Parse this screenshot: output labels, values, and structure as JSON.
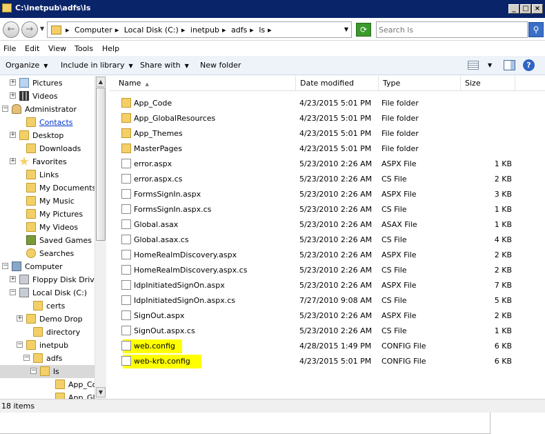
{
  "window": {
    "title": "C:\\inetpub\\adfs\\ls"
  },
  "address": {
    "crumbs": [
      "Computer",
      "Local Disk (C:)",
      "inetpub",
      "adfs",
      "ls"
    ],
    "search_placeholder": "Search ls"
  },
  "menu": {
    "items": [
      "File",
      "Edit",
      "View",
      "Tools",
      "Help"
    ]
  },
  "toolbar": {
    "organize": "Organize",
    "include": "Include in library",
    "share": "Share with",
    "new_folder": "New folder"
  },
  "nav": {
    "items": [
      {
        "label": "Pictures",
        "icon": "pictures-icon"
      },
      {
        "label": "Videos",
        "icon": "videos-icon"
      },
      {
        "label": "Administrator",
        "icon": "user-folder-icon"
      },
      {
        "label": "Contacts",
        "icon": "contacts-folder-icon"
      },
      {
        "label": "Desktop",
        "icon": "folder-icon"
      },
      {
        "label": "Downloads",
        "icon": "folder-icon"
      },
      {
        "label": "Favorites",
        "icon": "star-icon"
      },
      {
        "label": "Links",
        "icon": "folder-icon"
      },
      {
        "label": "My Documents",
        "icon": "folder-icon"
      },
      {
        "label": "My Music",
        "icon": "folder-icon"
      },
      {
        "label": "My Pictures",
        "icon": "folder-icon"
      },
      {
        "label": "My Videos",
        "icon": "folder-icon"
      },
      {
        "label": "Saved Games",
        "icon": "saved-games-icon"
      },
      {
        "label": "Searches",
        "icon": "search-folder-icon"
      },
      {
        "label": "Computer",
        "icon": "computer-icon"
      },
      {
        "label": "Floppy Disk Drive",
        "icon": "floppy-drive-icon"
      },
      {
        "label": "Local Disk (C:)",
        "icon": "local-disk-icon"
      },
      {
        "label": "certs",
        "icon": "folder-icon"
      },
      {
        "label": "Demo Drop",
        "icon": "folder-icon"
      },
      {
        "label": "directory",
        "icon": "folder-icon"
      },
      {
        "label": "inetpub",
        "icon": "folder-icon"
      },
      {
        "label": "adfs",
        "icon": "folder-icon"
      },
      {
        "label": "ls",
        "icon": "folder-icon"
      },
      {
        "label": "App_Cod",
        "icon": "folder-icon"
      },
      {
        "label": "App_Glo",
        "icon": "folder-icon"
      }
    ]
  },
  "columns": {
    "name": "Name",
    "date": "Date modified",
    "type": "Type",
    "size": "Size"
  },
  "files": [
    {
      "name": "App_Code",
      "date": "4/23/2015 5:01 PM",
      "type": "File folder",
      "size": "",
      "kind": "folder"
    },
    {
      "name": "App_GlobalResources",
      "date": "4/23/2015 5:01 PM",
      "type": "File folder",
      "size": "",
      "kind": "folder"
    },
    {
      "name": "App_Themes",
      "date": "4/23/2015 5:01 PM",
      "type": "File folder",
      "size": "",
      "kind": "folder"
    },
    {
      "name": "MasterPages",
      "date": "4/23/2015 5:01 PM",
      "type": "File folder",
      "size": "",
      "kind": "folder"
    },
    {
      "name": "error.aspx",
      "date": "5/23/2010 2:26 AM",
      "type": "ASPX File",
      "size": "1 KB",
      "kind": "file"
    },
    {
      "name": "error.aspx.cs",
      "date": "5/23/2010 2:26 AM",
      "type": "CS File",
      "size": "2 KB",
      "kind": "file"
    },
    {
      "name": "FormsSignIn.aspx",
      "date": "5/23/2010 2:26 AM",
      "type": "ASPX File",
      "size": "3 KB",
      "kind": "file"
    },
    {
      "name": "FormsSignIn.aspx.cs",
      "date": "5/23/2010 2:26 AM",
      "type": "CS File",
      "size": "1 KB",
      "kind": "file"
    },
    {
      "name": "Global.asax",
      "date": "5/23/2010 2:26 AM",
      "type": "ASAX File",
      "size": "1 KB",
      "kind": "file"
    },
    {
      "name": "Global.asax.cs",
      "date": "5/23/2010 2:26 AM",
      "type": "CS File",
      "size": "4 KB",
      "kind": "file"
    },
    {
      "name": "HomeRealmDiscovery.aspx",
      "date": "5/23/2010 2:26 AM",
      "type": "ASPX File",
      "size": "2 KB",
      "kind": "file"
    },
    {
      "name": "HomeRealmDiscovery.aspx.cs",
      "date": "5/23/2010 2:26 AM",
      "type": "CS File",
      "size": "2 KB",
      "kind": "file"
    },
    {
      "name": "IdpInitiatedSignOn.aspx",
      "date": "5/23/2010 2:26 AM",
      "type": "ASPX File",
      "size": "7 KB",
      "kind": "file"
    },
    {
      "name": "IdpInitiatedSignOn.aspx.cs",
      "date": "7/27/2010 9:08 AM",
      "type": "CS File",
      "size": "5 KB",
      "kind": "file"
    },
    {
      "name": "SignOut.aspx",
      "date": "5/23/2010 2:26 AM",
      "type": "ASPX File",
      "size": "2 KB",
      "kind": "file"
    },
    {
      "name": "SignOut.aspx.cs",
      "date": "5/23/2010 2:26 AM",
      "type": "CS File",
      "size": "1 KB",
      "kind": "file"
    },
    {
      "name": "web.config",
      "date": "4/28/2015 1:49 PM",
      "type": "CONFIG File",
      "size": "6 KB",
      "kind": "file",
      "highlight": true
    },
    {
      "name": "web-krb.config",
      "date": "4/23/2015 5:01 PM",
      "type": "CONFIG File",
      "size": "6 KB",
      "kind": "file",
      "highlight": true
    }
  ],
  "status": {
    "text": "18 items"
  },
  "colors": {
    "highlight": "#ffff00",
    "titlebar": "#0a246a"
  }
}
